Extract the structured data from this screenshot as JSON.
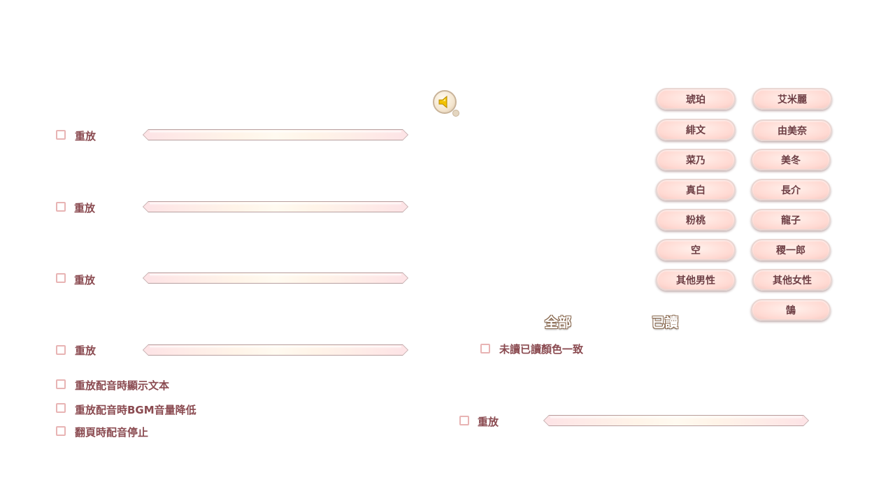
{
  "voice_rows": [
    {
      "replay_label": "重放"
    },
    {
      "replay_label": "重放"
    },
    {
      "replay_label": "重放"
    },
    {
      "replay_label": "重放"
    }
  ],
  "options": [
    {
      "label": "重放配音時顯示文本"
    },
    {
      "label": "重放配音時BGM音量降低"
    },
    {
      "label": "翻頁時配音停止"
    }
  ],
  "characters": [
    "琥珀",
    "艾米麗",
    "緋文",
    "由美奈",
    "菜乃",
    "美冬",
    "真白",
    "長介",
    "粉桃",
    "龍子",
    "空",
    "稷一郎",
    "其他男性",
    "其他女性",
    "鵠"
  ],
  "text_tabs": {
    "all": "全部",
    "read": "已讀"
  },
  "read_color_option": {
    "label": "未讀已讀顏色一致"
  },
  "right_replay": {
    "label": "重放"
  },
  "icons": {
    "speaker": "speaker-icon"
  },
  "colors": {
    "label": "#8a4a50",
    "checkbox_border": "#e8b4b4",
    "pill_fill": "#ffd9d2"
  }
}
